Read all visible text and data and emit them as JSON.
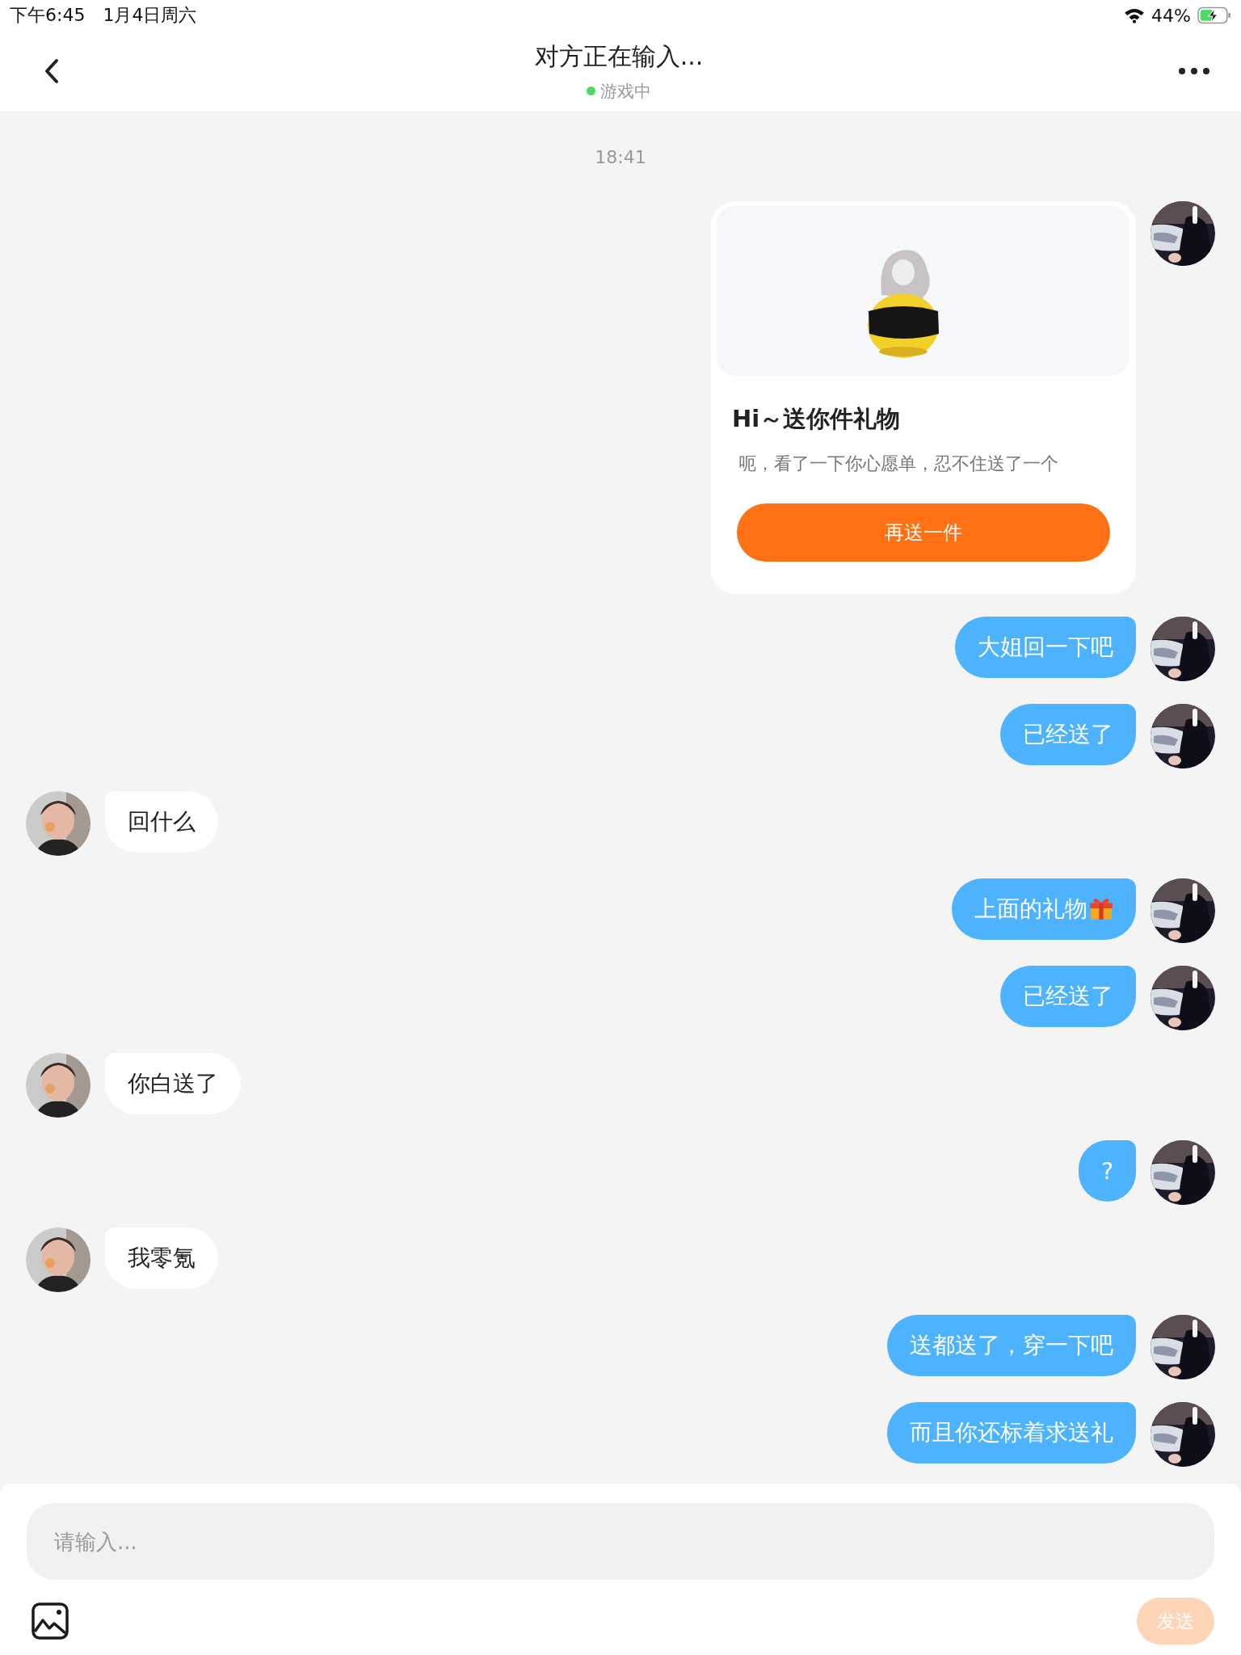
{
  "status_bar": {
    "time": "下午6:45",
    "date": "1月4日周六",
    "battery_percent": "44%",
    "charging": true
  },
  "header": {
    "title": "对方正在输入...",
    "presence": "游戏中",
    "online": true
  },
  "timestamp": "18:41",
  "messages": [
    {
      "kind": "gift_card",
      "title": "Hi～送你件礼物",
      "text": "呃，看了一下你心愿单，忍不住送了一个",
      "button": "再送一件"
    },
    {
      "outgoing": true,
      "kind": "text",
      "text": "大姐回一下吧",
      "gift_icon": false
    },
    {
      "outgoing": true,
      "kind": "text",
      "text": "已经送了",
      "gift_icon": false
    },
    {
      "outgoing": false,
      "kind": "text",
      "text": "回什么",
      "gift_icon": false
    },
    {
      "outgoing": true,
      "kind": "text",
      "text": "上面的礼物",
      "gift_icon": true
    },
    {
      "outgoing": true,
      "kind": "text",
      "text": "已经送了",
      "gift_icon": false
    },
    {
      "outgoing": false,
      "kind": "text",
      "text": "你白送了",
      "gift_icon": false
    },
    {
      "outgoing": true,
      "kind": "text",
      "text": "?",
      "gift_icon": false
    },
    {
      "outgoing": false,
      "kind": "text",
      "text": "我零氪",
      "gift_icon": false
    },
    {
      "outgoing": true,
      "kind": "text",
      "text": "送都送了，穿一下吧",
      "gift_icon": false
    },
    {
      "outgoing": true,
      "kind": "text",
      "text": "而且你还标着求送礼",
      "gift_icon": false
    }
  ],
  "composer": {
    "placeholder": "请输入...",
    "send_button": "发送",
    "send_disabled": true
  }
}
